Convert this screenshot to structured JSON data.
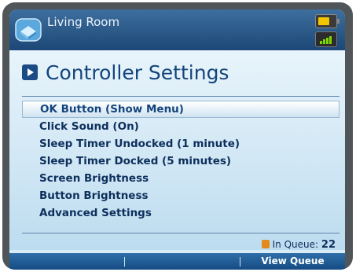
{
  "status_bar": {
    "room_name": "Living Room",
    "battery_level": 0.8,
    "signal_strength_bars": 4
  },
  "page": {
    "title": "Controller Settings"
  },
  "menu": {
    "items": [
      {
        "label": "OK Button (Show Menu)",
        "selected": true
      },
      {
        "label": "Click Sound (On)",
        "selected": false
      },
      {
        "label": "Sleep Timer Undocked (1 minute)",
        "selected": false
      },
      {
        "label": "Sleep Timer Docked (5 minutes)",
        "selected": false
      },
      {
        "label": "Screen Brightness",
        "selected": false
      },
      {
        "label": "Button Brightness",
        "selected": false
      },
      {
        "label": "Advanced Settings",
        "selected": false
      }
    ]
  },
  "queue": {
    "label": "In Queue:",
    "count": "22",
    "icon": "queue-icon"
  },
  "softkeys": {
    "left": "",
    "middle": "",
    "right": "View Queue"
  },
  "colors": {
    "accent": "#14447c",
    "menu_text": "#0d2f5c",
    "battery": "#f3c400",
    "signal": "#7dd800",
    "queue_icon": "#e48a1c"
  }
}
